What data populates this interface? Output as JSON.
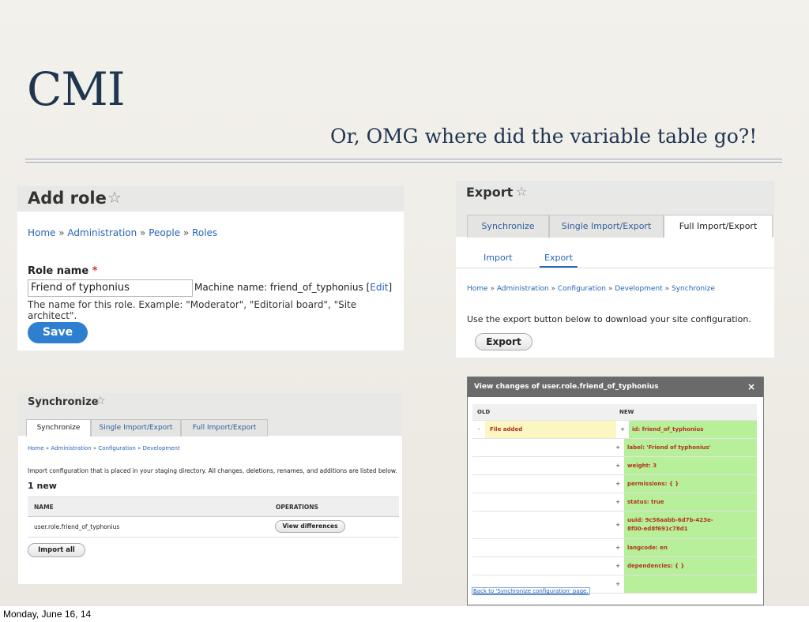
{
  "slide": {
    "title": "CMI",
    "subtitle": "Or, OMG where did the variable table go?!",
    "footer": "Monday, June 16, 14"
  },
  "add_role": {
    "title": "Add role",
    "breadcrumb": [
      "Home",
      "Administration",
      "People",
      "Roles"
    ],
    "field_label": "Role name",
    "required_mark": "*",
    "field_value": "Friend of typhonius",
    "machine_name": "Machine name: friend_of_typhonius [",
    "edit_link": "Edit",
    "machine_name_close": "]",
    "help": "The name for this role. Example: \"Moderator\", \"Editorial board\", \"Site architect\".",
    "save": "Save"
  },
  "export": {
    "title": "Export",
    "tabs": [
      "Synchronize",
      "Single Import/Export",
      "Full Import/Export"
    ],
    "subtabs": [
      "Import",
      "Export"
    ],
    "breadcrumb": [
      "Home",
      "Administration",
      "Configuration",
      "Development",
      "Synchronize"
    ],
    "description": "Use the export button below to download your site configuration.",
    "button": "Export"
  },
  "sync": {
    "title": "Synchronize",
    "tabs": [
      "Synchronize",
      "Single Import/Export",
      "Full Import/Export"
    ],
    "breadcrumb": [
      "Home",
      "Administration",
      "Configuration",
      "Development"
    ],
    "description": "Import configuration that is placed in your staging directory. All changes, deletions, renames, and additions are listed below.",
    "count": "1 new",
    "col_name": "NAME",
    "col_ops": "OPERATIONS",
    "row_name": "user.role.friend_of_typhonius",
    "row_button": "View differences",
    "import_all": "Import all"
  },
  "diff": {
    "title": "View changes of user.role.friend_of_typhonius",
    "close": "×",
    "col_old": "OLD",
    "col_new": "NEW",
    "old_sign": "-",
    "old_first": "File added",
    "new_sign": "+",
    "new_lines": [
      "id: friend_of_typhonius",
      "label: 'Friend of typhonius'",
      "weight: 3",
      "permissions: {  }",
      "status: true",
      "uuid: 9c56aabb-6d7b-423e-8f00-ed8f691c78d1",
      "langcode: en",
      "dependencies: {  }",
      ""
    ],
    "back_link": "Back to 'Synchronize configuration' page."
  },
  "colors": {
    "link": "#2766b5",
    "title": "#1f3550",
    "save": "#2f7fd0",
    "diff_added": "#b7ef9a",
    "diff_removed": "#fcf6c3",
    "diff_text": "#b3321e"
  }
}
